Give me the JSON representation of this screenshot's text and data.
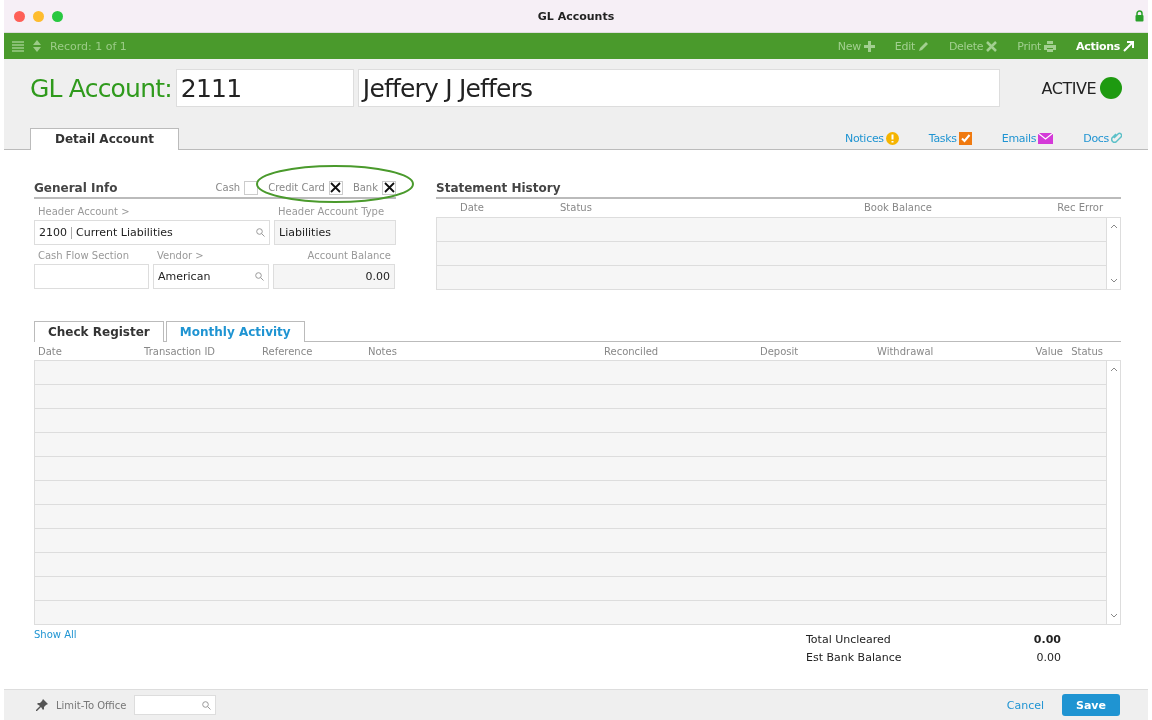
{
  "window": {
    "title": "GL Accounts"
  },
  "toolbar": {
    "record": "Record: 1 of 1",
    "actions": [
      {
        "label": "New",
        "kind": "plus",
        "disabled": true
      },
      {
        "label": "Edit",
        "kind": "pencil",
        "disabled": true
      },
      {
        "label": "Delete",
        "kind": "cross",
        "disabled": true
      },
      {
        "label": "Print",
        "kind": "printer",
        "disabled": true
      },
      {
        "label": "Actions",
        "kind": "arrow",
        "disabled": false
      }
    ]
  },
  "header": {
    "label": "GL Account:",
    "number": "2111",
    "name": "Jeffery J Jeffers",
    "status": "ACTIVE"
  },
  "tabs": [
    {
      "label": "Detail Account",
      "selected": true
    }
  ],
  "links": [
    {
      "label": "Notices",
      "kind": "notice"
    },
    {
      "label": "Tasks",
      "kind": "task"
    },
    {
      "label": "Emails",
      "kind": "email"
    },
    {
      "label": "Docs",
      "kind": "clip"
    }
  ],
  "general_info": {
    "title": "General Info",
    "flags": [
      {
        "label": "Cash",
        "checked": false
      },
      {
        "label": "Credit Card",
        "checked": true
      },
      {
        "label": "Bank",
        "checked": true
      }
    ],
    "header_account_label": "Header Account >",
    "header_account_code": "2100",
    "header_account_name": "Current Liabilities",
    "header_account_type_label": "Header Account Type",
    "header_account_type": "Liabilities",
    "cash_flow_label": "Cash Flow Section",
    "vendor_label": "Vendor >",
    "vendor": "American",
    "balance_label": "Account Balance",
    "balance": "0.00"
  },
  "annotation": {
    "kind": "ellipse"
  },
  "statement_history": {
    "title": "Statement History",
    "columns": [
      "Date",
      "Status",
      "Book Balance",
      "Rec Error"
    ]
  },
  "register_tabs": [
    {
      "label": "Check Register",
      "selected": true
    },
    {
      "label": "Monthly Activity",
      "selected": false
    }
  ],
  "register": {
    "columns": [
      "Date",
      "Transaction ID",
      "Reference",
      "Notes",
      "Reconciled",
      "Deposit",
      "Withdrawal",
      "Value",
      "Status"
    ]
  },
  "show_all": "Show All",
  "totals": [
    {
      "label": "Total Uncleared",
      "value": "0.00",
      "bold": true
    },
    {
      "label": "Est Bank Balance",
      "value": "0.00",
      "bold": false
    }
  ],
  "footer": {
    "limit_label": "Limit-To Office",
    "cancel": "Cancel",
    "save": "Save"
  }
}
